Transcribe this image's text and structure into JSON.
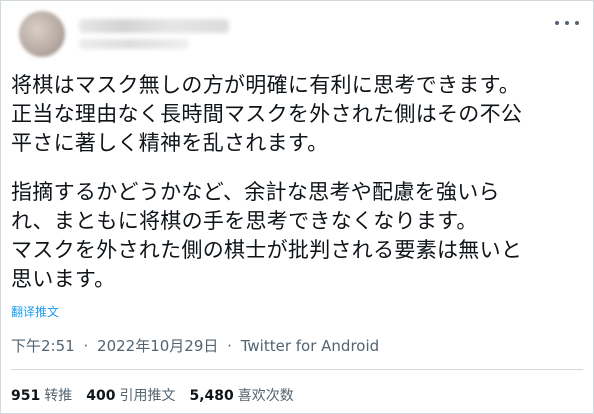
{
  "tweet": {
    "lines": [
      "将棋はマスク無しの方が明確に有利に思考できます。",
      "正当な理由なく長時間マスクを外された側はその不公",
      "平さに著しく精神を乱されます。",
      "指摘するかどうかなど、余計な思考や配慮を強いら",
      "れ、まともに将棋の手を思考できなくなります。",
      "マスクを外された側の棋士が批判される要素は無いと",
      "思います。"
    ],
    "translate_label": "翻译推文",
    "time": "下午2:51",
    "date": "2022年10月29日",
    "source": "Twitter for Android",
    "separator": "·"
  },
  "stats": {
    "retweets_count": "951",
    "retweets_label": "转推",
    "quotes_count": "400",
    "quotes_label": "引用推文",
    "likes_count": "5,480",
    "likes_label": "喜欢次数"
  },
  "icons": {
    "more": "more-icon"
  },
  "colors": {
    "link": "#1d9bf0",
    "muted": "#536471",
    "text": "#0f1419",
    "border": "#cfd9de"
  }
}
